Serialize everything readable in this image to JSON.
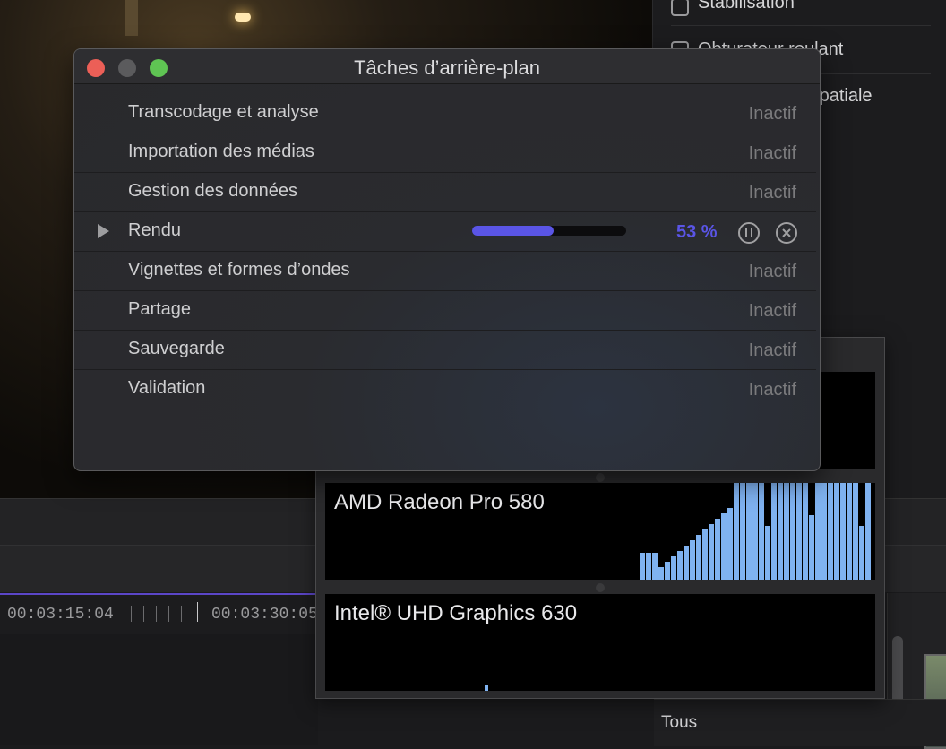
{
  "inspector": {
    "items": [
      {
        "label": "Stabilisation"
      },
      {
        "label": "Obturateur roulant"
      },
      {
        "label": "Conformation spatiale"
      }
    ]
  },
  "timeline": {
    "timecodes": [
      "00:03:15:04",
      "00:03:30:05"
    ]
  },
  "browser": {
    "filter_label": "Tous"
  },
  "tasks_window": {
    "title": "Tâches d’arrière-plan",
    "tasks": [
      {
        "name": "Transcodage et analyse",
        "status": "Inactif"
      },
      {
        "name": "Importation des médias",
        "status": "Inactif"
      },
      {
        "name": "Gestion des données",
        "status": "Inactif"
      },
      {
        "name": "Rendu",
        "status": "53 %",
        "progress": 0.53
      },
      {
        "name": "Vignettes et formes d’ondes",
        "status": "Inactif"
      },
      {
        "name": "Partage",
        "status": "Inactif"
      },
      {
        "name": "Sauvegarde",
        "status": "Inactif"
      },
      {
        "name": "Validation",
        "status": "Inactif"
      }
    ],
    "icons": [
      "close-icon",
      "minimize-icon",
      "zoom-icon",
      "disclosure-triangle-icon",
      "pause-icon",
      "cancel-icon"
    ]
  },
  "gpu_window": {
    "gpus": [
      {
        "name": "AMD Radeon Pro 580"
      },
      {
        "name": "Intel® UHD Graphics 630"
      }
    ]
  },
  "colors": {
    "accent": "#5a55e6",
    "gpu_bar": "#7fb2f0",
    "close": "#ec5f57",
    "minimize": "#5b5b5d",
    "zoom": "#5fc453",
    "playhead": "#5b46c8"
  }
}
